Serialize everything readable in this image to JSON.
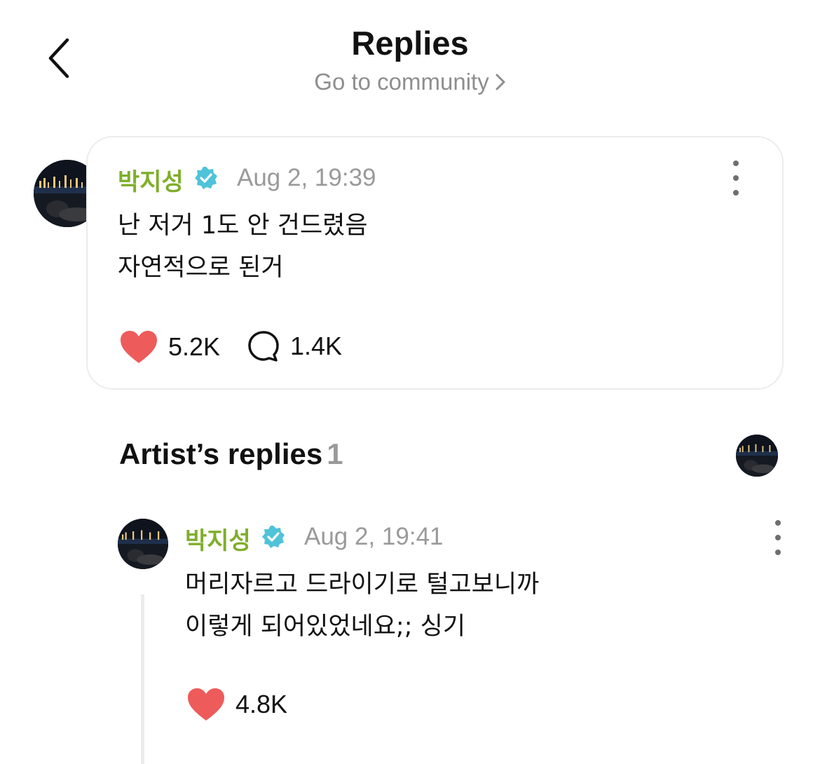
{
  "header": {
    "title": "Replies",
    "subtitle": "Go to community"
  },
  "post": {
    "username": "박지성",
    "timestamp": "Aug 2, 19:39",
    "body": "난 저거 1도 안 건드렸음\n자연적으로 된거",
    "likes": "5.2K",
    "comments": "1.4K"
  },
  "artist_replies": {
    "title": "Artist’s replies",
    "count": "1"
  },
  "reply": {
    "username": "박지성",
    "timestamp": "Aug 2, 19:41",
    "body": "머리자르고 드라이기로 털고보니까\n이렇게 되어있었네요;; 싱기",
    "likes": "4.8K"
  },
  "colors": {
    "username": "#7fae2b",
    "verified": "#4fc3d9",
    "heart": "#ee5b5b",
    "muted": "#8e8e8e"
  },
  "icons": {
    "back": "chevron-left-icon",
    "verified": "verified-badge-icon",
    "more": "more-vertical-icon",
    "like": "heart-icon",
    "comment": "comment-bubble-icon"
  }
}
